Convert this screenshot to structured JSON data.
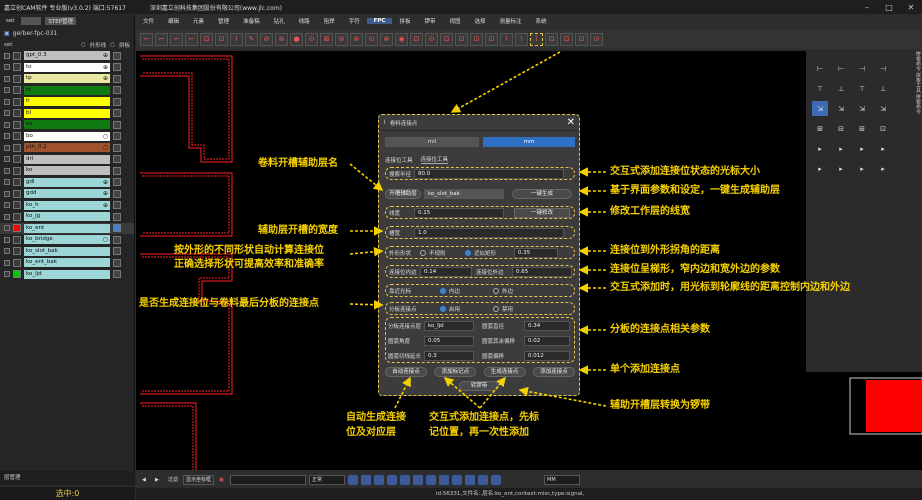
{
  "titlebar": {
    "app": "嘉立创CAM软件 专业版(v3.0.2) 端口:57617",
    "company": "深圳嘉立创科技集团股份有限公司(www.jlc.com)"
  },
  "menu": [
    "文件",
    "编辑",
    "元素",
    "管理",
    "准备稿",
    "钻孔",
    "线路",
    "阻焊",
    "字符",
    "FPC",
    "拼板",
    "锣带",
    "视图",
    "选择",
    "测量标注",
    "系统"
  ],
  "menu_active": "FPC",
  "left_panel": {
    "tabs": [
      "set",
      "STEP管理"
    ],
    "file": "gerber-fpc-031",
    "sub": {
      "set": "set",
      "outline": "外形线",
      "panel": "拼板"
    },
    "layers": [
      {
        "name": "gpt_0.3",
        "color": "#bfbfbf",
        "mark": "⊕"
      },
      {
        "name": "to",
        "color": "#ffffff",
        "mark": "⊕"
      },
      {
        "name": "tp",
        "color": "#e8e8a0",
        "mark": "⊕"
      },
      {
        "name": "ts",
        "color": "#0f7a0f",
        "mark": ""
      },
      {
        "name": "tl",
        "color": "#ffff00",
        "mark": ""
      },
      {
        "name": "bl",
        "color": "#ffff00",
        "mark": ""
      },
      {
        "name": "bs",
        "color": "#0f7a0f",
        "mark": ""
      },
      {
        "name": "bo",
        "color": "#ffffff",
        "mark": "○"
      },
      {
        "name": "pth_0.2",
        "color": "#a0522d",
        "mark": "○"
      },
      {
        "name": "drl",
        "color": "#bfbfbf",
        "mark": ""
      },
      {
        "name": "ko",
        "color": "#bfbfbf",
        "mark": ""
      },
      {
        "name": "gdl",
        "color": "#9cd6d6",
        "mark": "⊕"
      },
      {
        "name": "gdd",
        "color": "#9cd6d6",
        "mark": "⊕"
      },
      {
        "name": "ko_h",
        "color": "#9cd6d6",
        "mark": "⊕"
      },
      {
        "name": "ko_jg",
        "color": "#9cd6d6",
        "mark": ""
      },
      {
        "name": "ko_ent",
        "color": "#9cd6d6",
        "mark": "",
        "active": true
      },
      {
        "name": "ko_bridge",
        "color": "#9cd6d6",
        "mark": "○"
      },
      {
        "name": "ko_slot_bak",
        "color": "#9cd6d6",
        "mark": ""
      },
      {
        "name": "ko_ent_bak",
        "color": "#9cd6d6",
        "mark": ""
      },
      {
        "name": "ko_ljd",
        "color": "#9cd6d6",
        "mark": "",
        "swatch": "#00cc00"
      }
    ],
    "bottom_tab": "层管理",
    "selected": "选中:0"
  },
  "dialog": {
    "title": "卷料连接点",
    "units": [
      "mil",
      "mm"
    ],
    "unit_active": "mm",
    "mode_label": "连接位工具",
    "tool_label": "连接位工具",
    "search_radius": {
      "label": "搜索半径",
      "value": "80.0"
    },
    "aux_layer": {
      "button": "开槽辅助层",
      "value": "ko_slot_bak",
      "gen": "一键生成"
    },
    "line_width": {
      "label": "线宽",
      "value": "0.15",
      "btn": "一键修改"
    },
    "slot_width": {
      "label": "槽宽",
      "value": "1.0"
    },
    "shape": {
      "label": "外形形状",
      "opt1": "不规则",
      "opt2": "近似矩形",
      "value": "0.35"
    },
    "conn_pos": {
      "label_in": "连接位内边",
      "in": "0.14",
      "label_out": "连接位外边",
      "out": "0.65"
    },
    "add_mode": {
      "label": "靠近光标",
      "opt1": "内边",
      "opt2": "外边"
    },
    "last_panel": {
      "label": "分板连接点",
      "opt1": "启用",
      "opt2": "禁用"
    },
    "panel_params": [
      {
        "l1": "分板连接点层",
        "v1": "ko_ljd",
        "l2": "圆弧直径",
        "v2": "0.34"
      },
      {
        "l1": "圆弧角度",
        "v1": "0.05",
        "l2": "圆弧其余偏移",
        "v2": "0.02"
      },
      {
        "l1": "圆弧切线延长",
        "v1": "0.3",
        "l2": "圆弧偏移",
        "v2": "0.012"
      }
    ],
    "buttons": [
      "自动连接点",
      "添加标记点",
      "生成连接点",
      "添加连接点"
    ],
    "convert": "转锣带"
  },
  "annotations": {
    "cursor_size": "交互式添加连接位状态的光标大小",
    "aux_name": "卷料开槽辅助层名",
    "one_click": "基于界面参数和设定，一键生成辅助层",
    "modify_width": "修改工作层的线宽",
    "slot_width": "辅助层开槽的宽度",
    "shape_calc_1": "按外形的不同形状自动计算连接位",
    "shape_calc_2": "正确选择形状可提高效率和准确率",
    "corner_dist": "连接位到外形拐角的距离",
    "trapezoid": "连接位呈梯形，窄内边和宽外边的参数",
    "cursor_dist": "交互式添加时，用光标到轮廓线的距离控制内边和外边",
    "last_panel": "是否生成连接位与卷料最后分板的连接点",
    "panel_params": "分板的连接点相关参数",
    "single_add": "单个添加连接点",
    "convert": "辅助开槽层转换为锣带",
    "auto_1": "自动生成连接",
    "auto_2": "位及对应层",
    "interactive_1": "交互式添加连接点，先标",
    "interactive_2": "记位置，再一次性添加"
  },
  "bottombar": {
    "filter": "过滤",
    "display": "显示坐标框",
    "mode": "正常",
    "unit": "MM"
  },
  "status": "id:56331,文件名:,层名:ko_ent,context:misc,type:signal,"
}
